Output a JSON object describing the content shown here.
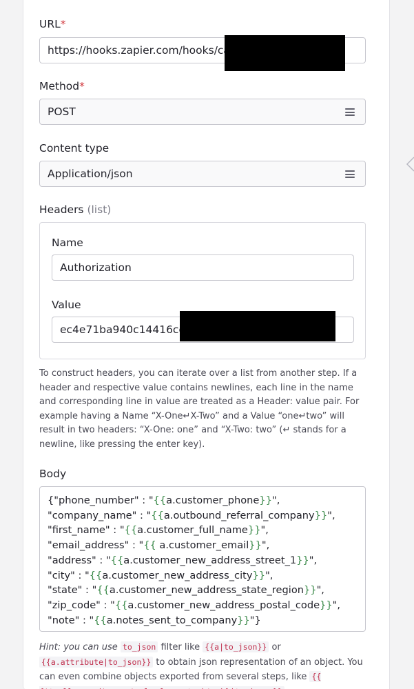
{
  "form": {
    "url": {
      "label": "URL",
      "required_mark": "*",
      "value": "https://hooks.zapier.com/hooks/catch"
    },
    "method": {
      "label": "Method",
      "required_mark": "*",
      "value": "POST",
      "icon": "menu-icon"
    },
    "content_type": {
      "label": "Content type",
      "value": "Application/json",
      "icon": "menu-icon"
    },
    "headers": {
      "label": "Headers",
      "qualifier": "(list)",
      "name_label": "Name",
      "name_value": "Authorization",
      "value_label": "Value",
      "value_value": "ec4e71ba940c14416ce7"
    },
    "headers_help": "To construct headers, you can iterate over a list from another step. If a header and respective value contains newlines, each line in the name and corresponding line in value are treated as a Header: value pair. For example having a Name “X-One↵X-Two” and a Value “one↵two” will result in two headers: “X-One: one” and “X-Two: two” (↵ stands for a newline, like pressing the enter key).",
    "body": {
      "label": "Body",
      "lines": [
        [
          "{\"phone_number\" : \"",
          "{{",
          "a.customer_phone",
          "}}",
          "\","
        ],
        [
          "\"company_name\" : \"",
          "{{",
          "a.outbound_referral_company",
          "}}",
          "\","
        ],
        [
          "\"first_name\" : \"",
          "{{",
          "a.customer_full_name",
          "}}",
          "\","
        ],
        [
          "\"email_address\" : \"",
          "{{",
          " a.customer_email",
          "}}",
          "\","
        ],
        [
          "\"address\" : \"",
          "{{",
          "a.customer_new_address_street_1",
          "}}",
          "\","
        ],
        [
          "\"city\" : \"",
          "{{",
          "a.customer_new_address_city",
          "}}",
          "\","
        ],
        [
          "\"state\" : \"",
          "{{",
          "a.customer_new_address_state_region",
          "}}",
          "\","
        ],
        [
          "\"zip_code\" : \"",
          "{{",
          "a.customer_new_address_postal_code",
          "}}",
          "\","
        ],
        [
          "\"note\" : \"",
          "{{",
          "a.notes_sent_to_company",
          "}}",
          "\"}"
        ]
      ]
    },
    "hint": {
      "lead": "Hint:",
      "t1": " you can use ",
      "c1": "to_json",
      "t2": " filter like ",
      "c2": "{{a|to_json}}",
      "t3": " or ",
      "c3": "{{a.attribute|to_json}}",
      "t4": " to obtain json representation of an object. You can even combine objects exported from several steps, like ",
      "c4": "{{ {'trello_card': a, 'salesforce_task': b}|to_json }}"
    }
  },
  "colors": {
    "required": "#d0353a",
    "template_braces": "#3b8a4a",
    "code": "#c0304d"
  }
}
